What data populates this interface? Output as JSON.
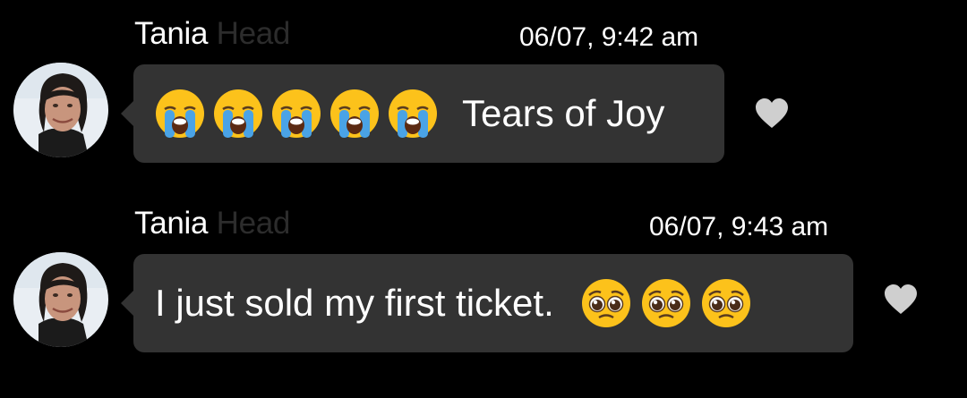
{
  "colors": {
    "background": "#000000",
    "bubble": "#333333",
    "text": "#ffffff",
    "faded_name": "#2c2c2c",
    "heart": "#cfcfcf"
  },
  "messages": [
    {
      "sender_first": "Tania ",
      "sender_last": "Head",
      "timestamp": "06/07, 9:42 am",
      "emoji": [
        "loudly-crying-face",
        "loudly-crying-face",
        "loudly-crying-face",
        "loudly-crying-face",
        "loudly-crying-face"
      ],
      "text": "Tears of Joy",
      "like_icon": "heart-icon"
    },
    {
      "sender_first": "Tania ",
      "sender_last": "Head",
      "timestamp": "06/07, 9:43 am",
      "text": "I just sold my first ticket.",
      "emoji": [
        "pleading-face",
        "pleading-face",
        "pleading-face"
      ],
      "like_icon": "heart-icon"
    }
  ]
}
